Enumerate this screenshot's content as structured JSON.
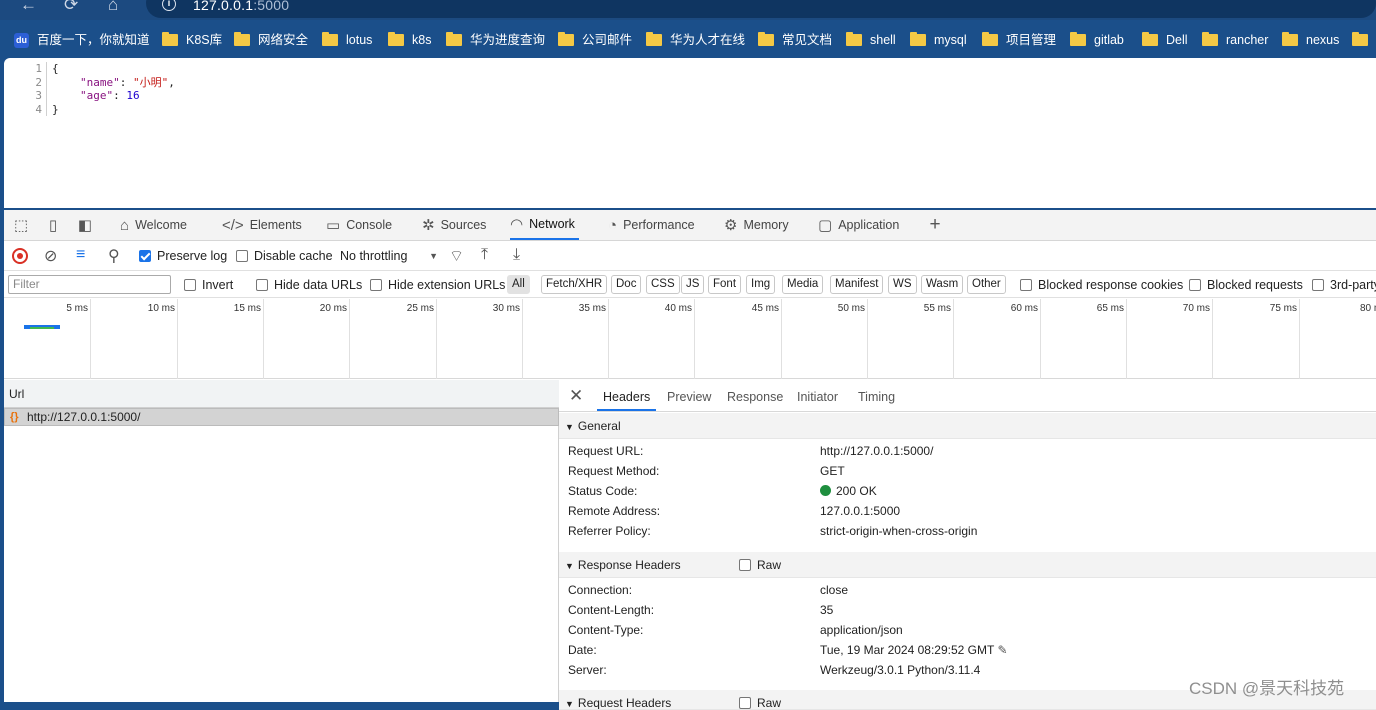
{
  "browser": {
    "url_host": "127.0.0.1",
    "url_port": ":5000",
    "nav": {
      "back": "←",
      "reload": "⟳",
      "home": "⌂"
    }
  },
  "bookmarks": [
    "百度一下，你就知道",
    "K8S库",
    "网络安全",
    "lotus",
    "k8s",
    "华为进度查询",
    "公司邮件",
    "华为人才在线",
    "常见文档",
    "shell",
    "mysql",
    "项目管理",
    "gitlab",
    "Dell",
    "rancher",
    "nexus"
  ],
  "json_view": {
    "line_numbers": [
      "1",
      "2",
      "3",
      "4"
    ],
    "open_brace": "{",
    "key1": "\"name\"",
    "val1": "\"小明\"",
    "key2": "\"age\"",
    "val2": "16",
    "close_brace": "}"
  },
  "devtools": {
    "tabs": [
      "Welcome",
      "Elements",
      "Console",
      "Sources",
      "Network",
      "Performance",
      "Memory",
      "Application"
    ],
    "active_tab": "Network",
    "toolbar": {
      "preserve_log": "Preserve log",
      "disable_cache": "Disable cache",
      "throttling": "No throttling"
    },
    "filter": {
      "placeholder": "Filter",
      "invert": "Invert",
      "hide_data_urls": "Hide data URLs",
      "hide_extension_urls": "Hide extension URLs",
      "types": [
        "All",
        "Fetch/XHR",
        "Doc",
        "CSS",
        "JS",
        "Font",
        "Img",
        "Media",
        "Manifest",
        "WS",
        "Wasm",
        "Other"
      ],
      "blocked_cookies": "Blocked response cookies",
      "blocked_requests": "Blocked requests",
      "third_party": "3rd-party"
    },
    "timeline_ticks": [
      "5 ms",
      "10 ms",
      "15 ms",
      "20 ms",
      "25 ms",
      "30 ms",
      "35 ms",
      "40 ms",
      "45 ms",
      "50 ms",
      "55 ms",
      "60 ms",
      "65 ms",
      "70 ms",
      "75 ms",
      "80 ms"
    ],
    "list": {
      "column": "Url",
      "rows": [
        "http://127.0.0.1:5000/"
      ]
    },
    "detail_tabs": [
      "Headers",
      "Preview",
      "Response",
      "Initiator",
      "Timing"
    ],
    "general": {
      "title": "General",
      "request_url_label": "Request URL:",
      "request_url": "http://127.0.0.1:5000/",
      "method_label": "Request Method:",
      "method": "GET",
      "status_label": "Status Code:",
      "status": "200 OK",
      "remote_label": "Remote Address:",
      "remote": "127.0.0.1:5000",
      "referrer_label": "Referrer Policy:",
      "referrer": "strict-origin-when-cross-origin"
    },
    "response_headers": {
      "title": "Response Headers",
      "raw": "Raw",
      "connection_label": "Connection:",
      "connection": "close",
      "length_label": "Content-Length:",
      "length": "35",
      "type_label": "Content-Type:",
      "type": "application/json",
      "date_label": "Date:",
      "date": "Tue, 19 Mar 2024 08:29:52 GMT",
      "server_label": "Server:",
      "server": "Werkzeug/3.0.1 Python/3.11.4"
    },
    "request_headers_partial": "Request Headers",
    "raw2": "Raw"
  },
  "watermark": "CSDN @景天科技苑",
  "colors": {
    "accent": "#1a73e8",
    "record": "#d93025",
    "status_ok": "#1e8e3e",
    "chrome_bg": "#1c4a80"
  }
}
